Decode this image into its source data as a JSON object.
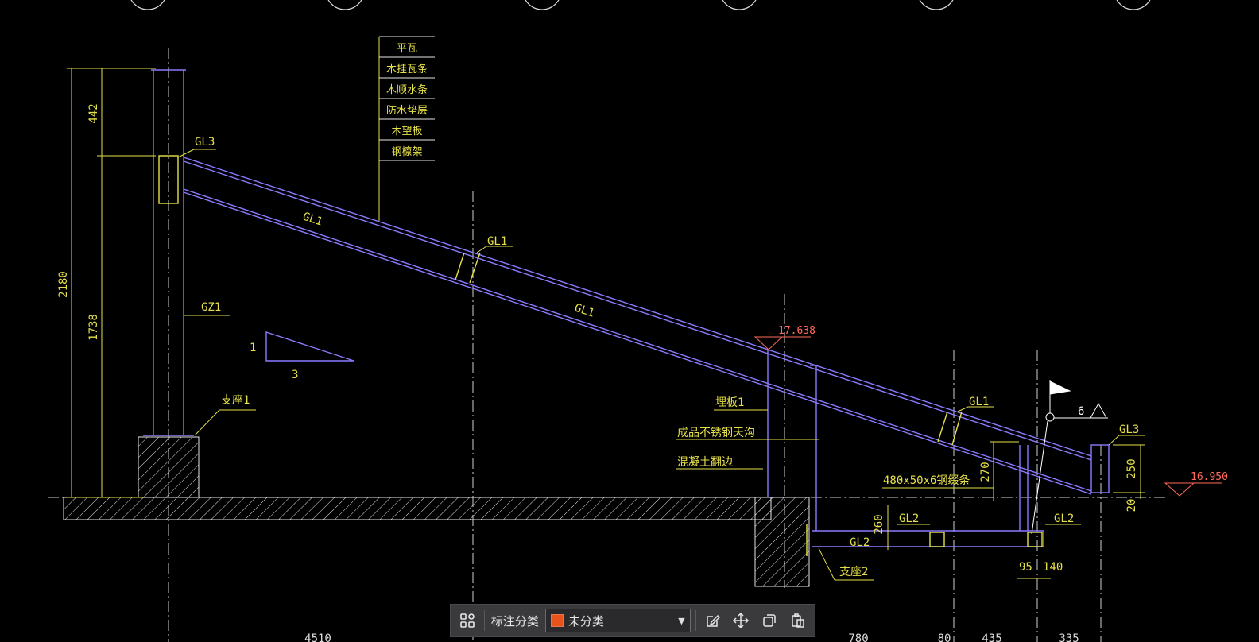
{
  "drawing": {
    "dims": {
      "total_height": "2180",
      "upper_segment": "442",
      "lower_segment": "1738",
      "d270": "270",
      "d250": "250",
      "d20": "20",
      "d260": "260",
      "d95": "95",
      "d140": "140",
      "d6": "6"
    },
    "levels": {
      "top": "17.638",
      "right": "16.950"
    },
    "slope": {
      "rise": "1",
      "run": "3"
    },
    "legend_layers": [
      "平瓦",
      "木挂瓦条",
      "木顺水条",
      "防水垫层",
      "木望板",
      "钢檩架"
    ],
    "labels": {
      "gl3_top": "GL3",
      "gl1_diag": "GL1",
      "gl1_mid": "GL1",
      "gl1_lower": "GL1",
      "gl1_right": "GL1",
      "gz1": "GZ1",
      "support1": "支座1",
      "embed_plate": "埋板1",
      "gutter": "成品不锈钢天沟",
      "concrete_upturn": "混凝土翻边",
      "steel_plate": "480x50x6钢缀条",
      "gl3_right": "GL3",
      "gl2_a": "GL2",
      "gl2_b": "GL2",
      "gl2_c": "GL2",
      "support2": "支座2"
    },
    "bottom_partial": {
      "b1": "4510",
      "b2": "780",
      "b3": "80",
      "b4": "435",
      "b5": "335"
    }
  },
  "toolbar": {
    "category_label": "标注分类",
    "category_value": "未分类",
    "category_color": "#e8541c"
  },
  "colors": {
    "structure": "#8a7bff",
    "annotation": "#e5e04a",
    "dimension": "#e5e04a",
    "hatch": "#f2f2f2",
    "level": "#ff6a5a",
    "text": "#e5e04a"
  }
}
